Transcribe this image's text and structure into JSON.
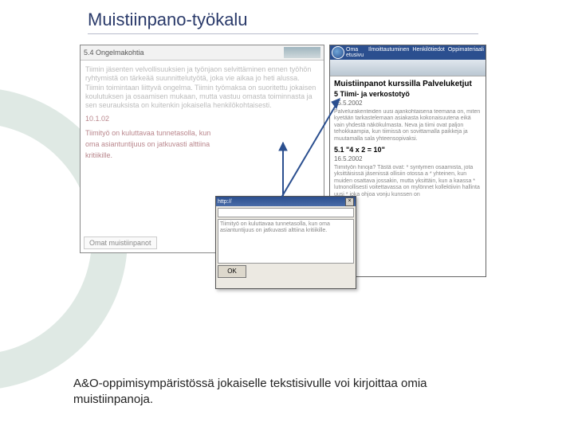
{
  "title": "Muistiinpano-työkalu",
  "caption": "A&O-oppimisympäristössä jokaiselle tekstisivulle voi kirjoittaa omia muistiinpanoja.",
  "left_window": {
    "header": "5.4 Ongelmakohtia",
    "body": "Tiimin jäsenten velvollisuuksien ja työnjaon selvittäminen ennen työhön ryhtymistä on tärkeää suunnittelutyötä, joka vie aikaa jo heti alussa. Tiimin toimintaan liittyvä ongelma. Tiimin työmaksa on suoritettu jokaisen koulutuksen ja osaamisen mukaan, mutta vastuu omasta toiminnasta ja sen seurauksista on kuitenkin jokaisella henkilökohtaisesti.",
    "date": "10.1.02",
    "lines": [
      "Tiimityö on kuluttavaa tunnetasolla, kun",
      "oma asiantuntijuus on jatkuvasti alttiina",
      "kritiikille."
    ],
    "footer": "Omat muistiinpanot"
  },
  "right_window": {
    "nav": [
      "Oma etusivu",
      "Ilmoittautuminen",
      "Henkilötiedot",
      "Oppimateriaali"
    ],
    "title": "Muistiinpanot kurssilla Palveluketjut",
    "section1_title": "5 Tiimi- ja verkostotyö",
    "section1_date": "15.5.2002",
    "section1_body": "Palvelurakenteiden uusi ajankohtaisena teemana on, miten kyetään tarkastelemaan asiakasta kokonaisuutena eikä vain yhdestä näkökulmasta. Neva ja tiimi ovat paljon tehokkaampia, kun tiimissä on sovittamalla paikkeja ja muutamalla sala yhteensopivaksi.",
    "section2_title": "5.1 \"4 x 2 = 10\"",
    "section2_date": "16.5.2002",
    "section2_body": "Tiimityön hinoja? Tästä ovat:\n\n* syntymen osaamista, jota yksittäisissä jäsenissä ollisiin otossa a\n* yhteinen, kun muiden osattava jossakin, mutta yksittäin, kun a kaassa\n* lutnonollisesti voitettavassa on mylönnet kollektiivin hallinta uusi\n* joka ohjoa vonju kunssen on"
  },
  "popup": {
    "title": "http://",
    "address": "",
    "body": "Tiimityö on kuluttavaa tunnetasolla, kun oma asiantuntijuus on jatkuvasti alttiina kritiikille.",
    "ok": "OK"
  }
}
